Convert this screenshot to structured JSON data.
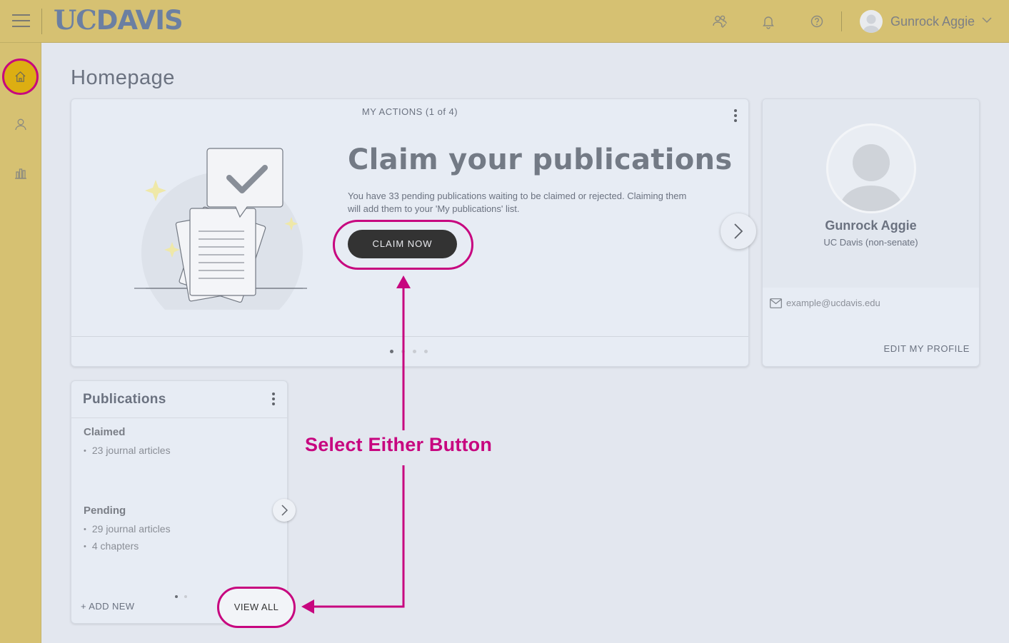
{
  "header": {
    "logo_uc": "UC",
    "logo_davis": "DAVIS",
    "user_name": "Gunrock Aggie"
  },
  "sidebar": {
    "items": [
      {
        "icon": "home-icon",
        "active": true
      },
      {
        "icon": "person-icon",
        "active": false
      },
      {
        "icon": "bar-chart-icon",
        "active": false
      }
    ]
  },
  "page": {
    "title": "Homepage"
  },
  "actions": {
    "label": "MY ACTIONS (1 of 4)",
    "heading": "Claim your publications",
    "text": "You have 33 pending publications waiting to be claimed or rejected. Claiming them will add them to your 'My publications' list.",
    "button": "CLAIM NOW",
    "page_count": 4,
    "current_page": 1
  },
  "profile": {
    "name": "Gunrock Aggie",
    "dept": "UC Davis (non-senate)",
    "email": "example@ucdavis.edu",
    "edit_label": "EDIT MY PROFILE"
  },
  "publications": {
    "title": "Publications",
    "claimed_heading": "Claimed",
    "claimed_items": [
      "23 journal articles"
    ],
    "pending_heading": "Pending",
    "pending_items": [
      "29 journal articles",
      "4 chapters"
    ],
    "add_new": "+ ADD NEW",
    "view_all": "VIEW ALL",
    "page_count": 2,
    "current_page": 1
  },
  "annotation": {
    "text": "Select Either Button",
    "color": "#c7067f"
  },
  "colors": {
    "header_bg": "#d6c172",
    "page_bg": "#e3e7ef",
    "accent": "#c7067f",
    "active_home": "#dcae12",
    "button_dark": "#333333"
  }
}
